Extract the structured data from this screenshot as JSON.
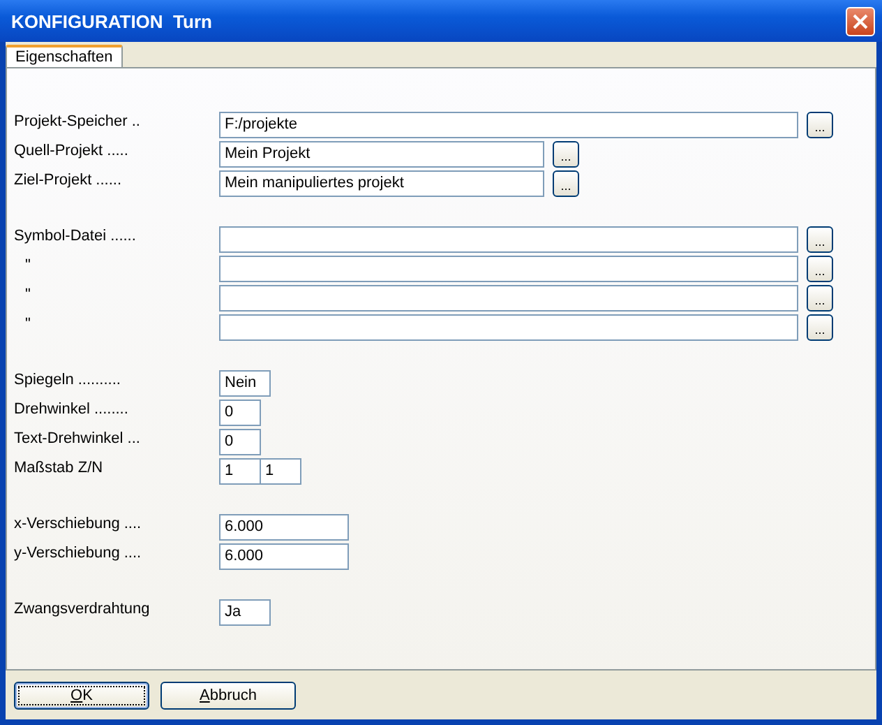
{
  "window": {
    "title": "KONFIGURATION  Turn"
  },
  "tabs": [
    {
      "label": "Eigenschaften",
      "selected": true
    }
  ],
  "groups": [
    {
      "rows": [
        {
          "label": "Projekt-Speicher ..",
          "kind": "path",
          "fields": [
            "F:/projekte"
          ],
          "browse": "..."
        },
        {
          "label": "Quell-Projekt .....",
          "kind": "project",
          "fields": [
            "Mein Projekt"
          ],
          "browse": "..."
        },
        {
          "label": "Ziel-Projekt ......",
          "kind": "project",
          "fields": [
            "Mein manipuliertes projekt"
          ],
          "browse": "..."
        }
      ]
    },
    {
      "rows": [
        {
          "label": "Symbol-Datei ......",
          "kind": "path",
          "browse": "..."
        },
        {
          "label": "\"",
          "kind": "path",
          "indent": true,
          "browse": "..."
        },
        {
          "label": "\"",
          "kind": "path",
          "indent": true,
          "browse": "..."
        },
        {
          "label": "\"",
          "kind": "path",
          "indent": true,
          "browse": "..."
        }
      ]
    },
    {
      "rows": [
        {
          "label": "Spiegeln ..........",
          "kind": "choice",
          "fields": [
            "Nein"
          ]
        },
        {
          "label": "Drehwinkel ........",
          "kind": "angle",
          "fields": [
            "0"
          ]
        },
        {
          "label": "Text-Drehwinkel ...",
          "kind": "angle",
          "fields": [
            "0"
          ]
        },
        {
          "label": "Maßstab Z/N",
          "kind": "angle",
          "fields": [
            "1",
            "1"
          ]
        }
      ]
    },
    {
      "rows": [
        {
          "label": "x-Verschiebung ....",
          "kind": "number",
          "fields": [
            "6.000"
          ]
        },
        {
          "label": "y-Verschiebung ....",
          "kind": "number",
          "fields": [
            "6.000"
          ]
        }
      ]
    },
    {
      "rows": [
        {
          "label": "Zwangsverdrahtung",
          "kind": "choice",
          "fields": [
            "Ja"
          ]
        }
      ]
    }
  ],
  "buttons": [
    {
      "label": "OK",
      "default": true
    },
    {
      "label": "Abbruch",
      "default": false
    }
  ]
}
